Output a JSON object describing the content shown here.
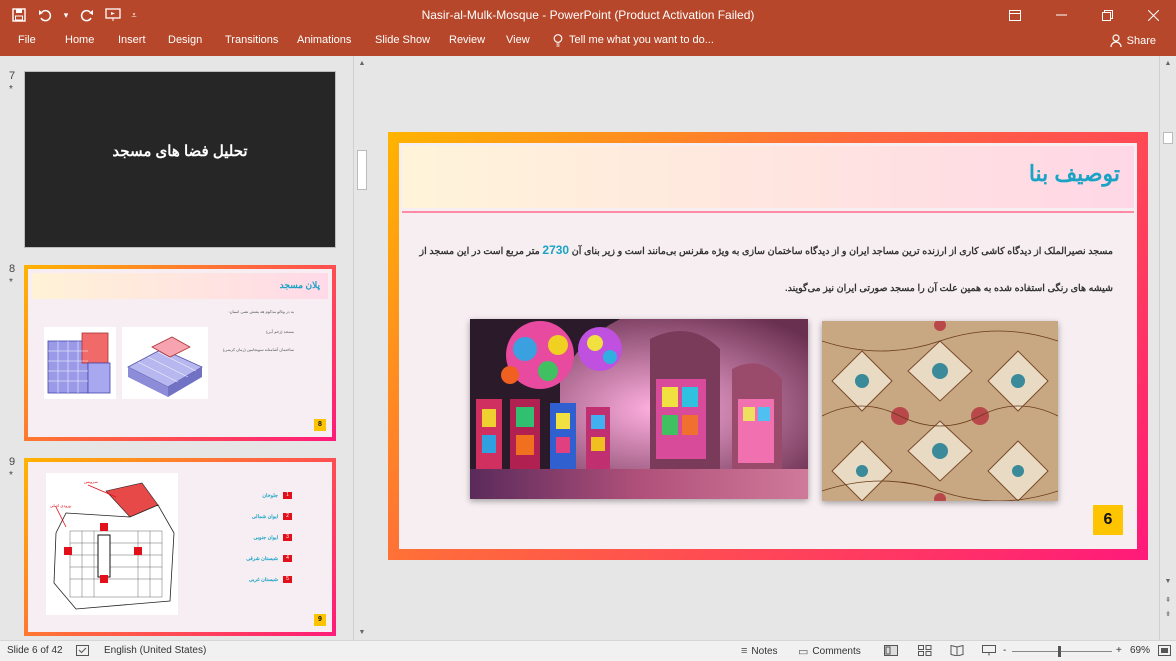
{
  "window": {
    "title": "Nasir-al-Mulk-Mosque - PowerPoint (Product Activation Failed)",
    "qat": [
      "save-icon",
      "undo-icon",
      "redo-icon",
      "present-icon",
      "customize-icon"
    ],
    "controls": [
      "ribbon-display-icon",
      "minimize-icon",
      "restore-icon",
      "close-icon"
    ]
  },
  "ribbon": {
    "tabs": [
      "File",
      "Home",
      "Insert",
      "Design",
      "Transitions",
      "Animations",
      "Slide Show",
      "Review",
      "View"
    ],
    "tell_me": "Tell me what you want to do...",
    "share": "Share"
  },
  "thumbnails": [
    {
      "number": "7",
      "star": "*",
      "title": "تحلیل فضا های مسجد"
    },
    {
      "number": "8",
      "star": "*",
      "title": "پلان مسجد",
      "text_lines": [
        "به در وتالو مذکوم هه یفتش نضی اسبان:",
        "مسجد (زخم آبی)",
        "ساختمان آشامتانه سوبجامین (زمان کرمنی)"
      ],
      "page": "8"
    },
    {
      "number": "9",
      "star": "*",
      "legend": [
        {
          "label": "جلوخان",
          "num": "1"
        },
        {
          "label": "ایوان شمالی",
          "num": "2"
        },
        {
          "label": "ایوان جنوبی",
          "num": "3"
        },
        {
          "label": "شبستان شرقی",
          "num": "4"
        },
        {
          "label": "شبستان غربی",
          "num": "5"
        }
      ],
      "plan_labels": [
        "ورودی اصلی",
        "سرویس",
        "ورودی"
      ],
      "page": "9"
    }
  ],
  "slide": {
    "title": "توصیف بنا",
    "line1_before": "مسجد نصیرالملک از دیدگاه کاشی کاری از ارزنده ترین مساجد ایران و از دیدگاه ساختمان سازی به ویژه مقرنس بی‌مانند است و زیر بنای آن",
    "area": "2730",
    "line1_after": "متر مربع است در این مسجد از",
    "line2": "شیشه های رنگی استفاده شده به همین علت آن را مسجد صورتی ایران نیز می‌گویند.",
    "number": "6"
  },
  "status": {
    "slide_info": "Slide 6 of 42",
    "language": "English (United States)",
    "notes": "Notes",
    "comments": "Comments",
    "zoom": "69%",
    "minus": "-",
    "plus": "+"
  },
  "colors": {
    "accent": "#b7472a",
    "title_teal": "#1aa3c4",
    "frame_gradient": [
      "#ffb400",
      "#ff6a3c",
      "#ff1a7a"
    ],
    "badge": "#ffc400"
  }
}
